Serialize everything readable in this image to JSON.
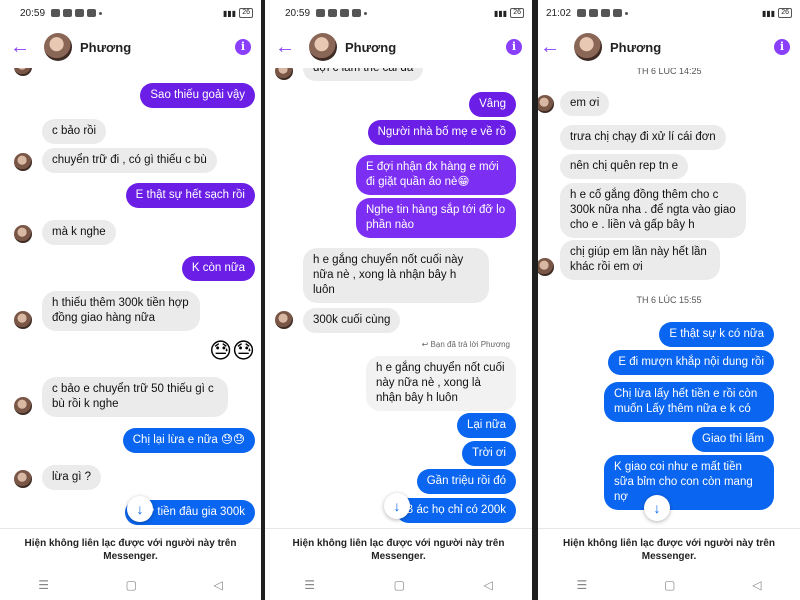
{
  "phones": [
    {
      "time": "20:59",
      "contact": "Phương",
      "battery": "26",
      "notice": "Hiện không liên lạc được với người này trên Messenger.",
      "messages": [
        "Sao thiếu goải vậy",
        "c bảo rồi",
        "chuyển trữ đi , có gì thiếu c bù",
        "E thật sự hết sạch rồi",
        "mà k nghe",
        "K còn nữa",
        "h thiếu thêm 300k tiền hợp đồng giao hàng nữa",
        "c bảo e chuyển trữ 50 thiếu gì c bù rồi k nghe",
        "Chị lại lừa e nữa 😓😓",
        "lừa gì ?",
        "Giờ     tiền đâu gia 300k"
      ],
      "emojis": "😓😓"
    },
    {
      "time": "20:59",
      "contact": "Phương",
      "battery": "26",
      "notice": "Hiện không liên lạc được với người này trên Messenger.",
      "messages": [
        "đợi c làm thế cái đã",
        "Vâng",
        "Người nhà bố mẹ e về rồ",
        "E đợi nhận đx hàng e mới đi giặt quần áo nè😁",
        "Nghe tin hàng sắp tới đỡ lo phần nào",
        "h e gắng chuyển nốt cuối này nữa nè , xong là nhận bây h luôn",
        "300k cuối cùng",
        "h e gắng chuyển nốt cuối này nữa nè , xong là nhận bây h luôn",
        "Lại nữa",
        "Trời ơi",
        "Gần triệu rồi đó",
        "B     ác họ chỉ có 200k"
      ],
      "reply_note": "Bạn đã trả lời Phương"
    },
    {
      "time": "21:02",
      "contact": "Phương",
      "battery": "26",
      "notice": "Hiện không liên lạc được với người này trên Messenger.",
      "stamps": [
        "TH 6 LÚC 14:25",
        "TH 6 LÚC 15:55"
      ],
      "messages": [
        "em ơi",
        "trưa chị chạy đi xử lí cái đơn",
        "nên chị quên rep tn e",
        "h e cố gắng đồng thêm cho c 300k nữa nha . để ngta vào giao cho e . liền và gấp bây h",
        "chị giúp em lần này hết lần khác rồi em ơi",
        "E thật sự k có nữa",
        "E đi mượn khắp nội dung rồi",
        "Chị lừa lấy hết tiền e rồi còn muốn Lấy thêm nữa e k có",
        "Giao thì lấm",
        "K giao coi như e mất tiền sữa bỉm cho con còn mang nợ"
      ]
    }
  ],
  "icons": {
    "back": "arrow-left-icon",
    "info": "info-icon",
    "scroll": "arrow-down-icon"
  },
  "colors": {
    "accent": "#8a3ffc",
    "outgoing_purple": "#6b1fe6",
    "outgoing_blue": "#0a66f0",
    "incoming": "#ebebeb"
  }
}
